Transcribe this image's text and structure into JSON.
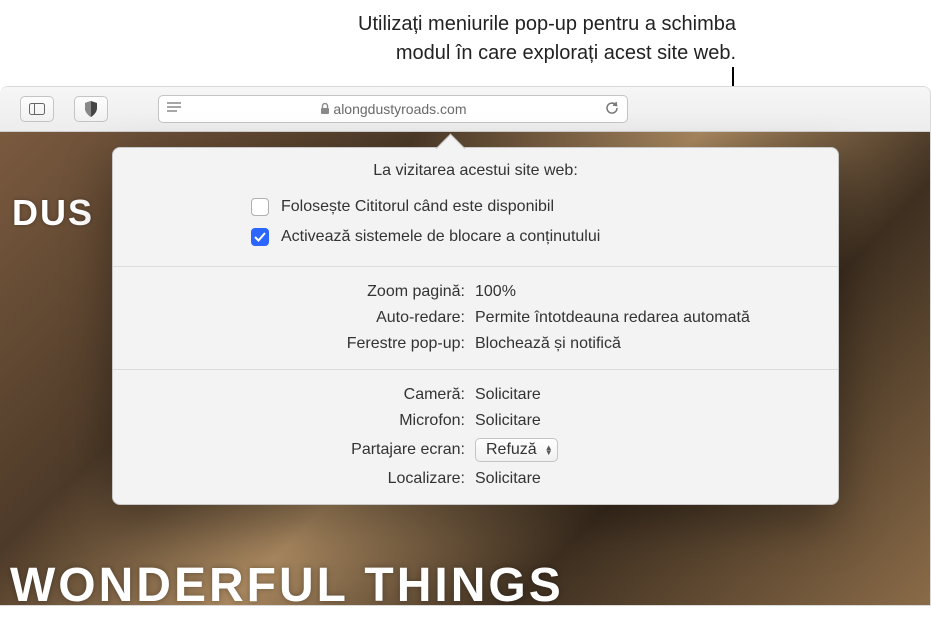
{
  "caption": {
    "line1": "Utilizați meniurile pop-up pentru a schimba",
    "line2": "modul în care explorați acest site web."
  },
  "addressbar": {
    "url": "alongdustyroads.com"
  },
  "bg": {
    "top_word": "DUS",
    "bottom_word": "WONDERFUL THINGS"
  },
  "popover": {
    "title": "La vizitarea acestui site web:",
    "reader_label": "Folosește Cititorul când este disponibil",
    "reader_checked": false,
    "blockers_label": "Activează sistemele de blocare a conținutului",
    "blockers_checked": true,
    "group1": [
      {
        "label": "Zoom pagină:",
        "value": "100%"
      },
      {
        "label": "Auto-redare:",
        "value": "Permite întotdeauna redarea automată"
      },
      {
        "label": "Ferestre pop-up:",
        "value": "Blochează și notifică"
      }
    ],
    "group2": [
      {
        "label": "Cameră:",
        "value": "Solicitare"
      },
      {
        "label": "Microfon:",
        "value": "Solicitare"
      },
      {
        "label": "Partajare ecran:",
        "value": "Refuză",
        "select": true
      },
      {
        "label": "Localizare:",
        "value": "Solicitare"
      }
    ]
  }
}
